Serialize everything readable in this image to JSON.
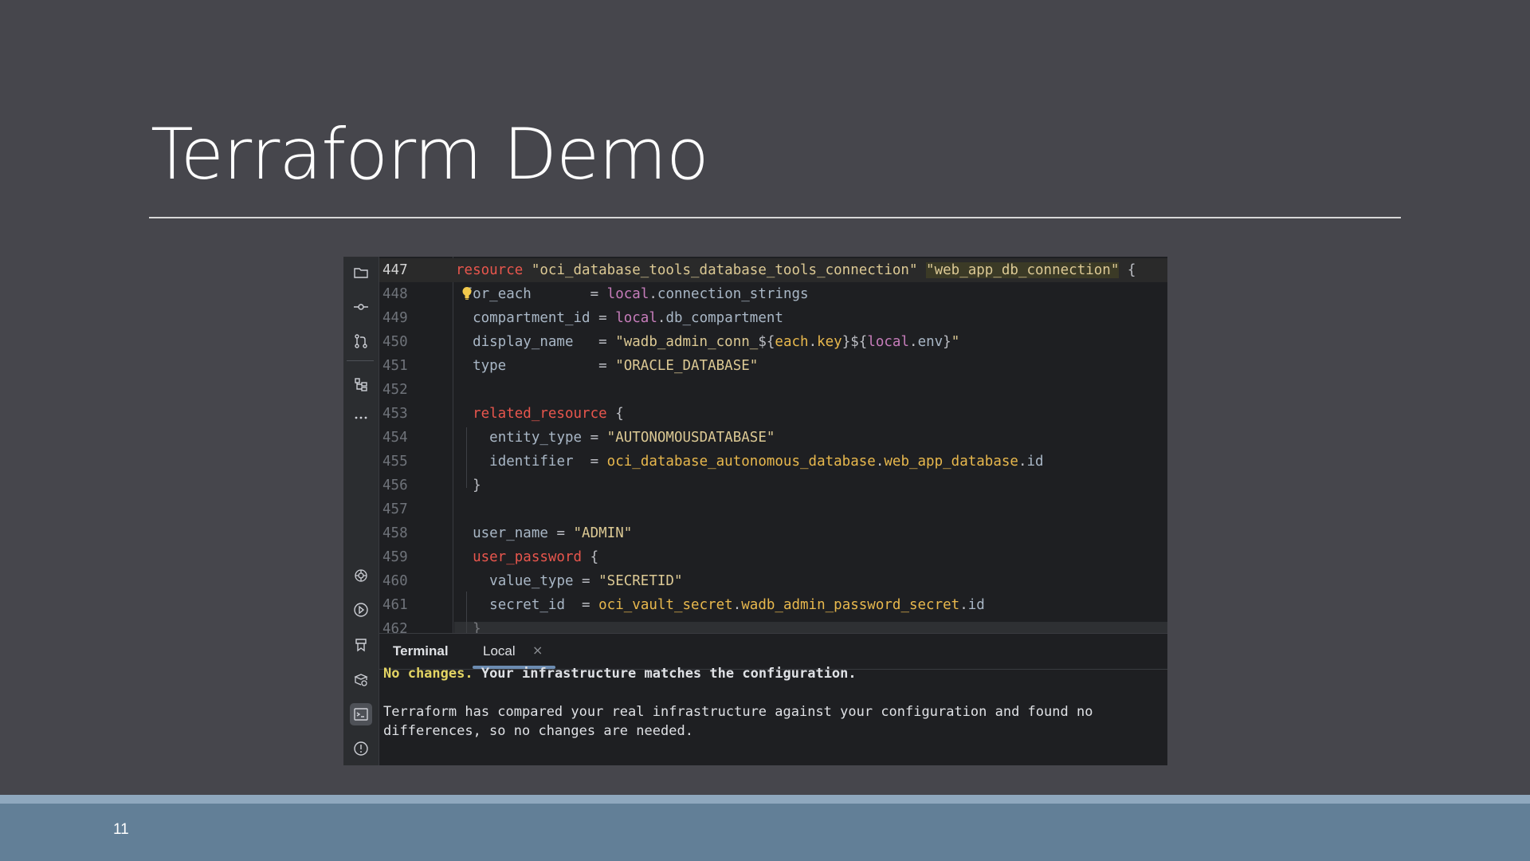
{
  "slide": {
    "title": "Terraform Demo",
    "number": "11"
  },
  "toolbar": {
    "icons": [
      "folder-icon",
      "commit-icon",
      "pull-request-icon",
      "structure-icon",
      "more-icon",
      "ai-assistant-icon",
      "run-icon",
      "bookmark-icon",
      "services-icon",
      "terminal-icon",
      "problems-icon"
    ],
    "active": "terminal-icon"
  },
  "editor": {
    "lines": [
      {
        "n": "447",
        "parts": [
          [
            "kw",
            "resource"
          ],
          [
            "t",
            " "
          ],
          [
            "str",
            "\"oci_database_tools_database_tools_connection\""
          ],
          [
            "t",
            " "
          ],
          [
            "strhl",
            "\"web_app_db_connection\""
          ],
          [
            "t",
            " {"
          ]
        ]
      },
      {
        "n": "448",
        "parts": [
          [
            "t",
            " "
          ],
          [
            "attr",
            "for_each"
          ],
          [
            "t",
            "       = "
          ],
          [
            "lcl",
            "local"
          ],
          [
            "t",
            "."
          ],
          [
            "attr",
            "connection_strings"
          ]
        ]
      },
      {
        "n": "449",
        "parts": [
          [
            "t",
            "  "
          ],
          [
            "attr",
            "compartment_id"
          ],
          [
            "t",
            " = "
          ],
          [
            "lcl",
            "local"
          ],
          [
            "t",
            "."
          ],
          [
            "attr",
            "db_compartment"
          ]
        ]
      },
      {
        "n": "450",
        "parts": [
          [
            "t",
            "  "
          ],
          [
            "attr",
            "display_name"
          ],
          [
            "t",
            "   = "
          ],
          [
            "str",
            "\"wadb_admin_conn_"
          ],
          [
            "t",
            "${"
          ],
          [
            "ref",
            "each"
          ],
          [
            "t",
            "."
          ],
          [
            "ref",
            "key"
          ],
          [
            "t",
            "}${"
          ],
          [
            "lcl",
            "local"
          ],
          [
            "t",
            "."
          ],
          [
            "attr",
            "env"
          ],
          [
            "t",
            "}"
          ],
          [
            "str",
            "\""
          ]
        ]
      },
      {
        "n": "451",
        "parts": [
          [
            "t",
            "  "
          ],
          [
            "attr",
            "type"
          ],
          [
            "t",
            "           = "
          ],
          [
            "str",
            "\"ORACLE_DATABASE\""
          ]
        ]
      },
      {
        "n": "452",
        "parts": []
      },
      {
        "n": "453",
        "parts": [
          [
            "t",
            "  "
          ],
          [
            "kw",
            "related_resource"
          ],
          [
            "t",
            " {"
          ]
        ]
      },
      {
        "n": "454",
        "parts": [
          [
            "t",
            "    "
          ],
          [
            "attr",
            "entity_type"
          ],
          [
            "t",
            " = "
          ],
          [
            "str",
            "\"AUTONOMOUSDATABASE\""
          ]
        ]
      },
      {
        "n": "455",
        "parts": [
          [
            "t",
            "    "
          ],
          [
            "attr",
            "identifier"
          ],
          [
            "t",
            "  = "
          ],
          [
            "ref",
            "oci_database_autonomous_database"
          ],
          [
            "t",
            "."
          ],
          [
            "ref",
            "web_app_database"
          ],
          [
            "t",
            "."
          ],
          [
            "attr",
            "id"
          ]
        ]
      },
      {
        "n": "456",
        "parts": [
          [
            "t",
            "  }"
          ]
        ]
      },
      {
        "n": "457",
        "parts": []
      },
      {
        "n": "458",
        "parts": [
          [
            "t",
            "  "
          ],
          [
            "attr",
            "user_name"
          ],
          [
            "t",
            " = "
          ],
          [
            "str",
            "\"ADMIN\""
          ]
        ]
      },
      {
        "n": "459",
        "parts": [
          [
            "t",
            "  "
          ],
          [
            "kw",
            "user_password"
          ],
          [
            "t",
            " {"
          ]
        ]
      },
      {
        "n": "460",
        "parts": [
          [
            "t",
            "    "
          ],
          [
            "attr",
            "value_type"
          ],
          [
            "t",
            " = "
          ],
          [
            "str",
            "\"SECRETID\""
          ]
        ]
      },
      {
        "n": "461",
        "parts": [
          [
            "t",
            "    "
          ],
          [
            "attr",
            "secret_id"
          ],
          [
            "t",
            "  = "
          ],
          [
            "ref",
            "oci_vault_secret"
          ],
          [
            "t",
            "."
          ],
          [
            "ref",
            "wadb_admin_password_secret"
          ],
          [
            "t",
            "."
          ],
          [
            "attr",
            "id"
          ]
        ]
      },
      {
        "n": "462",
        "parts": [
          [
            "t",
            "  }"
          ]
        ]
      }
    ]
  },
  "terminal": {
    "title": "Terminal",
    "tab_label": "Local",
    "close_glyph": "×",
    "status_prefix": "No changes.",
    "status_rest": " Your infrastructure matches the configuration.",
    "message_line1": "Terraform has compared your real infrastructure against your configuration and found no",
    "message_line2": "differences, so no changes are needed."
  },
  "colors": {
    "slide_bg": "#46464c",
    "footer": "#627f97",
    "keyword": "#e8564d",
    "string": "#dcc994",
    "reference": "#e8b84d",
    "local": "#c77dbb"
  }
}
